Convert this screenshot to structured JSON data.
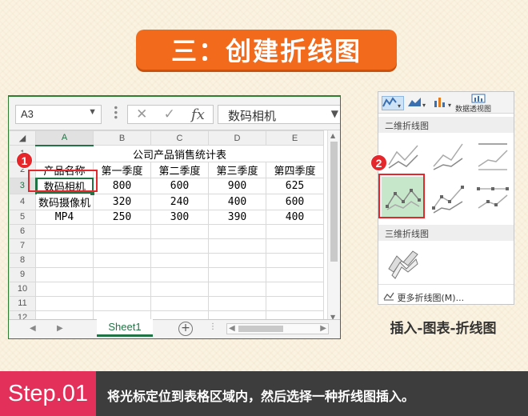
{
  "banner": {
    "title": "三：创建折线图"
  },
  "excel": {
    "namebox": "A3",
    "formula_content": "数码相机",
    "columns": [
      "A",
      "B",
      "C",
      "D",
      "E"
    ],
    "rows": [
      "1",
      "2",
      "3",
      "4",
      "5",
      "6",
      "7",
      "8",
      "9",
      "10",
      "11",
      "12"
    ],
    "table_title": "公司产品销售统计表",
    "headers": [
      "产品名称",
      "第一季度",
      "第二季度",
      "第三季度",
      "第四季度"
    ],
    "data": [
      [
        "数码相机",
        "800",
        "600",
        "900",
        "625"
      ],
      [
        "数码摄像机",
        "320",
        "240",
        "400",
        "600"
      ],
      [
        "MP4",
        "250",
        "300",
        "390",
        "400"
      ]
    ],
    "sheet_tab": "Sheet1"
  },
  "markers": {
    "one": "1",
    "two": "2"
  },
  "panel": {
    "pivot_label": "数据透视图",
    "section_2d": "二维折线图",
    "section_3d": "三维折线图",
    "more": "更多折线图(M)..."
  },
  "caption": "插入-图表-折线图",
  "step": {
    "tag": "Step.01",
    "text": "将光标定位到表格区域内，然后选择一种折线图插入。"
  },
  "colors": {
    "accent_orange": "#f26b1d",
    "step_pink": "#e2305b",
    "excel_green": "#217346",
    "marker_red": "#e5262a"
  }
}
